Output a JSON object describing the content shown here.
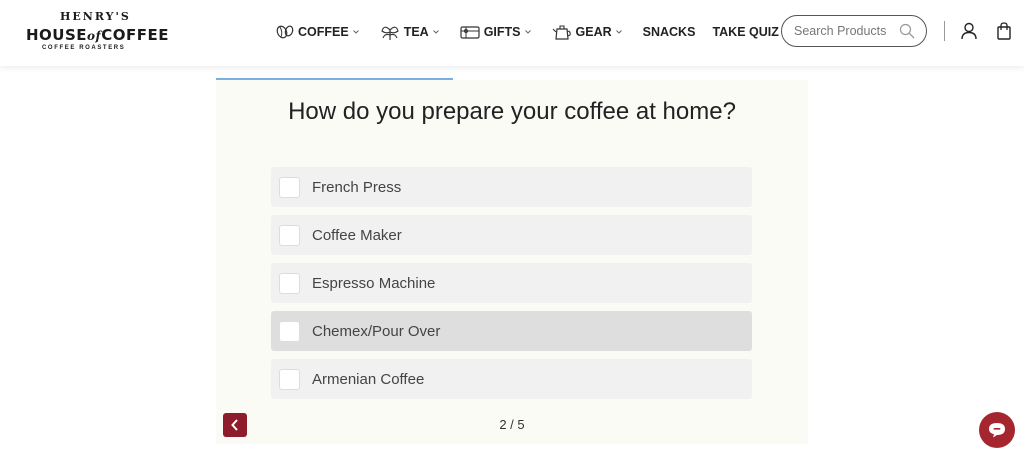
{
  "brand": {
    "logo_top": "HENRY'S",
    "logo_main_left": "HOUSE",
    "logo_main_amp": "of",
    "logo_main_right": "COFFEE",
    "logo_sub": "COFFEE ROASTERS"
  },
  "nav": {
    "items": [
      {
        "label": "COFFEE",
        "icon": "coffee-bean-icon",
        "has_dropdown": true
      },
      {
        "label": "TEA",
        "icon": "tea-leaf-icon",
        "has_dropdown": true
      },
      {
        "label": "GIFTS",
        "icon": "gift-card-icon",
        "has_dropdown": true
      },
      {
        "label": "GEAR",
        "icon": "kettle-icon",
        "has_dropdown": true
      },
      {
        "label": "SNACKS",
        "has_dropdown": false
      },
      {
        "label": "TAKE QUIZ",
        "has_dropdown": false
      }
    ]
  },
  "search": {
    "placeholder": "Search Products"
  },
  "quiz": {
    "question": "How do you prepare your coffee at home?",
    "progress": 0.4,
    "options": [
      {
        "label": "French Press",
        "checked": false
      },
      {
        "label": "Coffee Maker",
        "checked": false
      },
      {
        "label": "Espresso Machine",
        "checked": false
      },
      {
        "label": "Chemex/Pour Over",
        "checked": false,
        "hovered": true
      },
      {
        "label": "Armenian Coffee",
        "checked": false
      }
    ],
    "page_indicator": "2 / 5"
  },
  "colors": {
    "accent_red": "#8f1c2a",
    "chat_red": "#a5262f",
    "progress_blue": "#7aaedc",
    "panel_bg": "#fbfbf6"
  }
}
